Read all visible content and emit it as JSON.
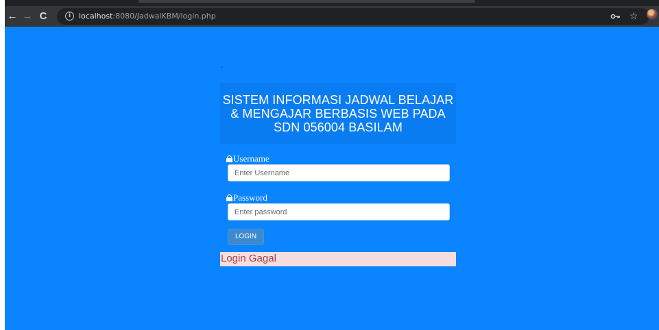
{
  "browser": {
    "url_host": "localhost",
    "url_path": ":8080/JadwalKBM/login.php",
    "icons": {
      "back": "arrow-left-icon",
      "forward": "arrow-right-icon",
      "reload": "reload-icon",
      "info": "info-icon",
      "key": "key-icon",
      "star": "star-icon"
    }
  },
  "page": {
    "background_color": "#0b84ff",
    "tick_mark": "`",
    "title": "SISTEM INFORMASI JADWAL BELAJAR & MENGAJAR BERBASIS WEB PADA SDN 056004 BASILAM",
    "username": {
      "label": "Username",
      "placeholder": "Enter Username",
      "value": ""
    },
    "password": {
      "label": "Password",
      "placeholder": "Enter password",
      "value": ""
    },
    "login_button": "LOGIN",
    "alert": {
      "text": "Login Gagal",
      "background": "#f6dde0",
      "color": "#a5424a"
    }
  }
}
